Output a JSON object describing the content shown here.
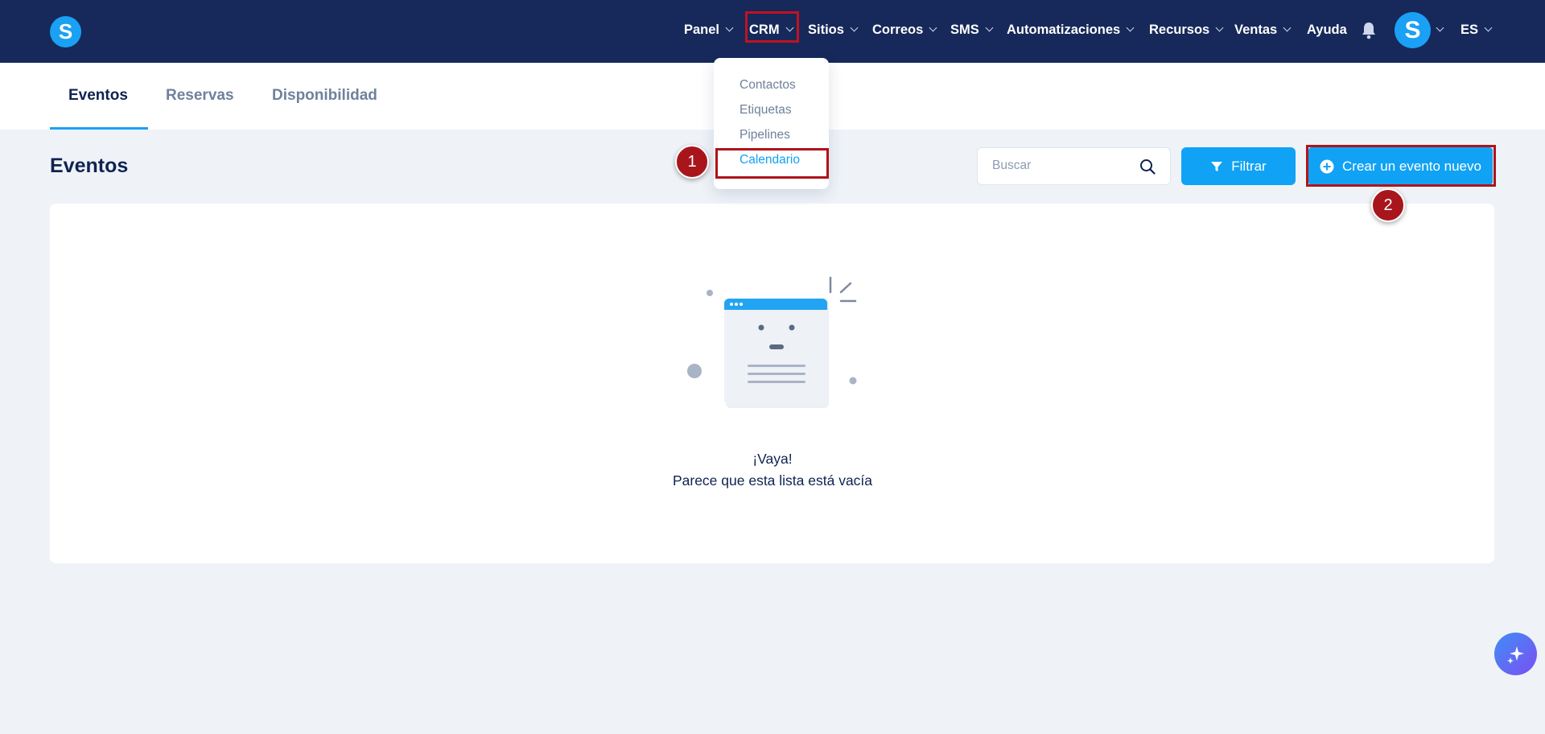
{
  "nav": {
    "logo_letter": "S",
    "items": [
      {
        "label": "Panel"
      },
      {
        "label": "CRM"
      },
      {
        "label": "Sitios"
      },
      {
        "label": "Correos"
      },
      {
        "label": "SMS"
      },
      {
        "label": "Automatizaciones"
      },
      {
        "label": "Recursos"
      },
      {
        "label": "Ventas"
      }
    ],
    "help_label": "Ayuda",
    "avatar_letter": "S",
    "language": "ES"
  },
  "tabs": [
    {
      "label": "Eventos",
      "active": true
    },
    {
      "label": "Reservas",
      "active": false
    },
    {
      "label": "Disponibilidad",
      "active": false
    }
  ],
  "crm_menu": {
    "items": [
      {
        "label": "Contactos"
      },
      {
        "label": "Etiquetas"
      },
      {
        "label": "Pipelines"
      },
      {
        "label": "Calendario",
        "active": true
      }
    ]
  },
  "page": {
    "title": "Eventos",
    "search_placeholder": "Buscar",
    "filter_label": "Filtrar",
    "create_label": "Crear un evento nuevo"
  },
  "empty_state": {
    "title": "¡Vaya!",
    "subtitle": "Parece que esta lista está vacía"
  },
  "annotations": {
    "step1": "1",
    "step2": "2"
  },
  "colors": {
    "nav_bg": "#16295a",
    "accent": "#10a2f5",
    "highlight_box": "#b01319",
    "page_bg": "#eff3f8"
  }
}
